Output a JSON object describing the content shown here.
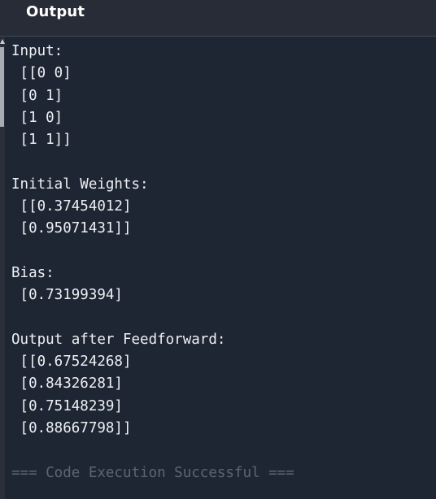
{
  "header": {
    "title": "Output"
  },
  "console": {
    "lines": [
      "Input:",
      " [[0 0]",
      " [0 1]",
      " [1 0]",
      " [1 1]]",
      "",
      "Initial Weights:",
      " [[0.37454012]",
      " [0.95071431]]",
      "",
      "Bias:",
      " [0.73199394]",
      "",
      "Output after Feedforward:",
      " [[0.67524268]",
      " [0.84326281]",
      " [0.75148239]",
      " [0.88667798]]",
      "",
      "=== Code Execution Successful ==="
    ]
  }
}
